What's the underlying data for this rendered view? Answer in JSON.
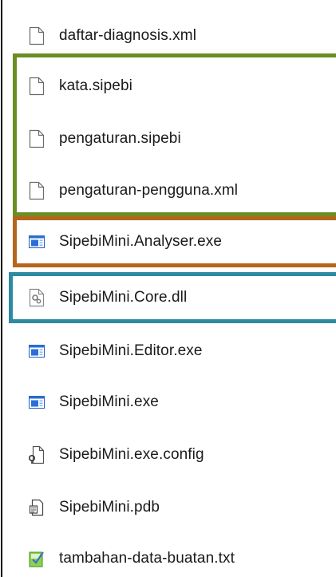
{
  "files": [
    {
      "name": "daftar-diagnosis.xml",
      "icon": "blank-file-icon"
    },
    {
      "name": "kata.sipebi",
      "icon": "blank-file-icon"
    },
    {
      "name": "pengaturan.sipebi",
      "icon": "blank-file-icon"
    },
    {
      "name": "pengaturan-pengguna.xml",
      "icon": "blank-file-icon"
    },
    {
      "name": "SipebiMini.Analyser.exe",
      "icon": "exe-window-icon"
    },
    {
      "name": "SipebiMini.Core.dll",
      "icon": "dll-gear-icon"
    },
    {
      "name": "SipebiMini.Editor.exe",
      "icon": "exe-window-icon"
    },
    {
      "name": "SipebiMini.exe",
      "icon": "exe-window-icon"
    },
    {
      "name": "SipebiMini.exe.config",
      "icon": "config-file-icon"
    },
    {
      "name": "SipebiMini.pdb",
      "icon": "pdb-file-icon"
    },
    {
      "name": "tambahan-data-buatan.txt",
      "icon": "notepad-file-icon"
    }
  ],
  "highlight_colors": {
    "green": "#6b8e23",
    "orange": "#b5651d",
    "teal": "#2e8aa0"
  }
}
